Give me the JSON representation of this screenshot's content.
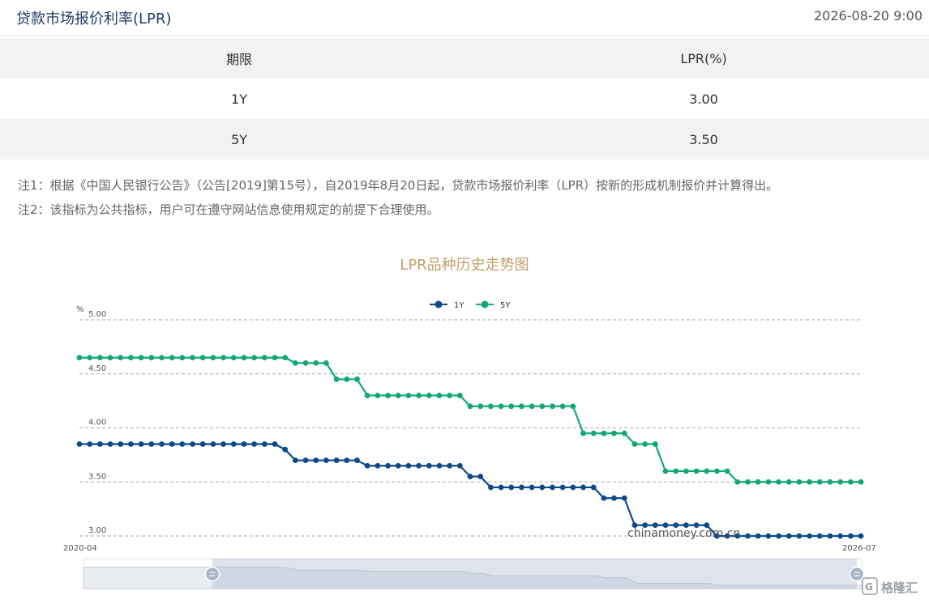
{
  "header": {
    "title": "贷款市场报价利率(LPR)",
    "timestamp": "2026-08-20 9:00"
  },
  "table": {
    "headers": [
      "期限",
      "LPR(%)"
    ],
    "rows": [
      {
        "term": "1Y",
        "rate": "3.00"
      },
      {
        "term": "5Y",
        "rate": "3.50"
      }
    ]
  },
  "notes": [
    "注1：根据《中国人民银行公告》（公告[2019]第15号），自2019年8月20日起，贷款市场报价利率（LPR）按新的形成机制报价并计算得出。",
    "注2：该指标为公共指标，用户可在遵守网站信息使用规定的前提下合理使用。"
  ],
  "watermark": "chinamoney.com.cn",
  "corner_logo": "格隆汇",
  "colors": {
    "title": "#1f3a66",
    "chart_title": "#c4a06a",
    "series_1y": "#0e4a8a",
    "series_5y": "#12a876",
    "grid": "#aaaaaa"
  },
  "chart_data": {
    "type": "line",
    "title": "LPR品种历史走势图",
    "ylabel": "%",
    "ylim": [
      3.0,
      5.0
    ],
    "yticks": [
      "3.00",
      "3.50",
      "4.00",
      "4.50",
      "5.00"
    ],
    "x_start_label": "2020-04",
    "x_end_label": "2026-07",
    "grid": "horizontal dashed",
    "legend": "top-center",
    "series": [
      {
        "name": "1Y",
        "values": [
          3.85,
          3.85,
          3.85,
          3.85,
          3.85,
          3.85,
          3.85,
          3.85,
          3.85,
          3.85,
          3.85,
          3.85,
          3.85,
          3.85,
          3.85,
          3.85,
          3.85,
          3.85,
          3.85,
          3.85,
          3.8,
          3.7,
          3.7,
          3.7,
          3.7,
          3.7,
          3.7,
          3.7,
          3.65,
          3.65,
          3.65,
          3.65,
          3.65,
          3.65,
          3.65,
          3.65,
          3.65,
          3.65,
          3.55,
          3.55,
          3.45,
          3.45,
          3.45,
          3.45,
          3.45,
          3.45,
          3.45,
          3.45,
          3.45,
          3.45,
          3.45,
          3.35,
          3.35,
          3.35,
          3.1,
          3.1,
          3.1,
          3.1,
          3.1,
          3.1,
          3.1,
          3.1,
          3.0,
          3.0,
          3.0,
          3.0,
          3.0,
          3.0,
          3.0,
          3.0,
          3.0,
          3.0,
          3.0,
          3.0,
          3.0,
          3.0,
          3.0
        ]
      },
      {
        "name": "5Y",
        "values": [
          4.65,
          4.65,
          4.65,
          4.65,
          4.65,
          4.65,
          4.65,
          4.65,
          4.65,
          4.65,
          4.65,
          4.65,
          4.65,
          4.65,
          4.65,
          4.65,
          4.65,
          4.65,
          4.65,
          4.65,
          4.65,
          4.6,
          4.6,
          4.6,
          4.6,
          4.45,
          4.45,
          4.45,
          4.3,
          4.3,
          4.3,
          4.3,
          4.3,
          4.3,
          4.3,
          4.3,
          4.3,
          4.3,
          4.2,
          4.2,
          4.2,
          4.2,
          4.2,
          4.2,
          4.2,
          4.2,
          4.2,
          4.2,
          4.2,
          3.95,
          3.95,
          3.95,
          3.95,
          3.95,
          3.85,
          3.85,
          3.85,
          3.6,
          3.6,
          3.6,
          3.6,
          3.6,
          3.6,
          3.6,
          3.5,
          3.5,
          3.5,
          3.5,
          3.5,
          3.5,
          3.5,
          3.5,
          3.5,
          3.5,
          3.5,
          3.5,
          3.5
        ]
      }
    ]
  }
}
